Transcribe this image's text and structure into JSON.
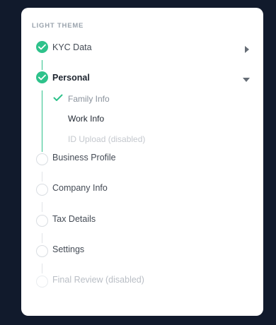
{
  "panel": {
    "section_title": "LIGHT THEME",
    "accent_color": "#2ec28b"
  },
  "steps": [
    {
      "label": "KYC Data",
      "state": "done",
      "icon": "check-icon",
      "caret": "chevron-right-icon"
    },
    {
      "label": "Personal",
      "state": "done",
      "icon": "check-icon",
      "caret": "chevron-down-icon",
      "expanded": true,
      "substeps": [
        {
          "label": "Family Info",
          "state": "done",
          "icon": "check-icon"
        },
        {
          "label": "Work Info",
          "state": "active"
        },
        {
          "label": "ID Upload (disabled)",
          "state": "disabled"
        }
      ]
    },
    {
      "label": "Business Profile",
      "state": "pending"
    },
    {
      "label": "Company Info",
      "state": "pending"
    },
    {
      "label": "Tax Details",
      "state": "pending"
    },
    {
      "label": "Settings",
      "state": "pending"
    },
    {
      "label": "Final Review (disabled)",
      "state": "disabled"
    }
  ]
}
